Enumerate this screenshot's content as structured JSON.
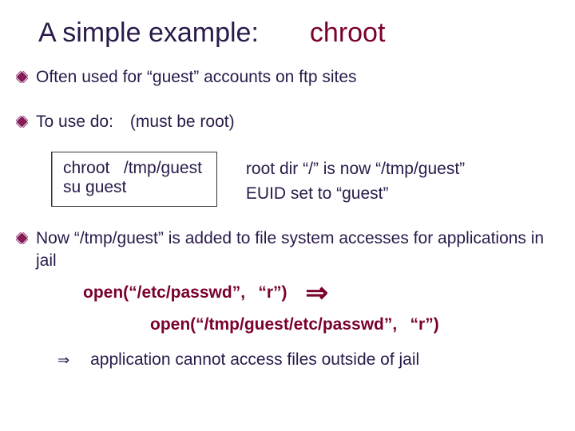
{
  "title": {
    "part1": "A simple example:",
    "part2": "chroot"
  },
  "bullets": {
    "b1": "Often used for “guest” accounts on ftp sites",
    "b2": "To use do: (must be root)",
    "b3": "Now  “/tmp/guest”  is added to file system accesses for applications in jail"
  },
  "code": {
    "line1": "chroot   /tmp/guest",
    "line2": "su guest"
  },
  "desc": {
    "line1": "root dir “/” is now “/tmp/guest”",
    "line2": "EUID set to “guest”"
  },
  "open": {
    "line1": "open(“/etc/passwd”,  “r”) ",
    "arrow": "⇒",
    "line2": "open(“/tmp/guest/etc/passwd”,  “r”)"
  },
  "conclusion": {
    "arrow": "⇒",
    "text": "application cannot access files outside of jail"
  }
}
